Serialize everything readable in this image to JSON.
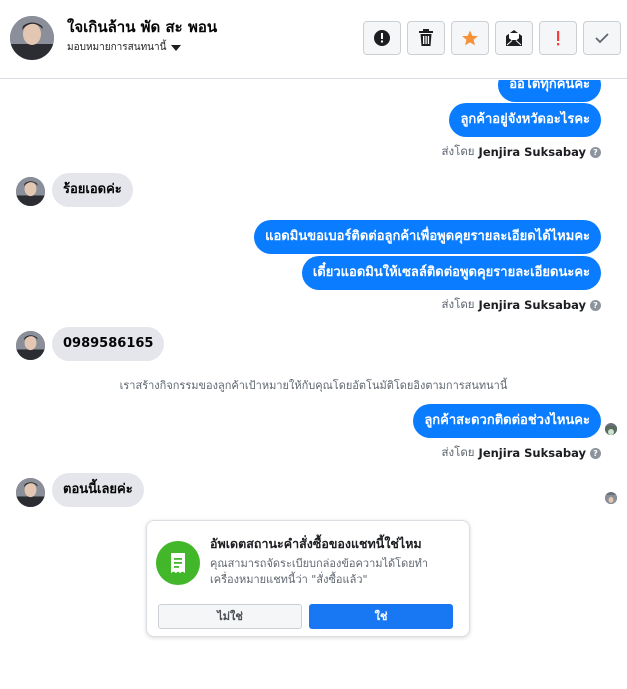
{
  "header": {
    "contact_name": "ใจเกินล้าน พัด สะ พอน",
    "assign_label": "มอบหมายการสนทนานี้",
    "actions": [
      {
        "name": "mark-spam-button",
        "icon": "alert-circle-icon"
      },
      {
        "name": "delete-button",
        "icon": "trash-icon"
      },
      {
        "name": "star-button",
        "icon": "star-icon",
        "color": "#f7923b"
      },
      {
        "name": "mark-unread-button",
        "icon": "envelope-open-icon"
      },
      {
        "name": "follow-up-button",
        "icon": "exclamation-icon",
        "color": "#fa3e3e"
      },
      {
        "name": "mark-done-button",
        "icon": "check-icon"
      }
    ]
  },
  "conversation": {
    "out_group_1": [
      "ออโตทุกคนคะ",
      "ลูกค้าอยู่จังหวัดอะไรคะ"
    ],
    "sent_by_prefix": "ส่งโดย",
    "sent_by_name": "Jenjira Suksabay",
    "in_1": "ร้อยเอดค่ะ",
    "out_group_2": [
      "แอดมินขอเบอร์ติดต่อลูกค้าเพื่อพูดคุยรายละเอียดได้ไหมคะ",
      "เดี๋ยวแอดมินให้เซลล์ติดต่อพูดคุยรายละเอียดนะคะ"
    ],
    "in_2": "0989586165",
    "system_note": "เราสร้างกิจกรรมของลูกค้าเป้าหมายให้กับคุณโดยอัตโนมัติโดยอิงตามการสนทนานี้",
    "out_3": "ลูกค้าสะดวกติดต่อช่วงไหนคะ",
    "in_3": "ตอนนี้เลยค่ะ"
  },
  "prompt_card": {
    "title": "อัพเดตสถานะคำสั่งซื้อของแชทนี้ใช่ไหม",
    "body": "คุณสามารถจัดระเบียบกล่องข้อความได้โดยทำเครื่องหมายแชทนี้ว่า \"สั่งซื้อแล้ว\"",
    "no_label": "ไม่ใช่",
    "yes_label": "ใช่",
    "icon": "order-receipt-icon"
  },
  "colors": {
    "outgoing_bubble": "#0a7cff",
    "incoming_bubble": "#e4e6eb",
    "confirm_button": "#1877f2",
    "card_icon_bg": "#42b72a"
  }
}
